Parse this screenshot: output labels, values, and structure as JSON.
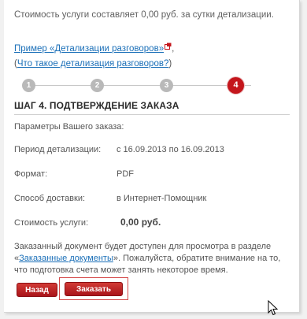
{
  "cost_note": "Стоимость услуги составляет 0,00 руб. за сутки детализации.",
  "links": {
    "example": "Пример «Детализации разговоров»",
    "example_suffix": ",",
    "whatis_open": "(",
    "whatis": "Что такое детализация разговоров?",
    "whatis_close": ")"
  },
  "stepper": {
    "steps": [
      "1",
      "2",
      "3",
      "4"
    ],
    "active_step": 4
  },
  "step_title": "ШАГ 4. ПОДТВЕРЖДЕНИЕ ЗАКАЗА",
  "params": {
    "heading": "Параметры Вашего заказа:",
    "period_label": "Период детализации:",
    "period_value": "с 16.09.2013 по 16.09.2013",
    "format_label": "Формат:",
    "format_value": "PDF",
    "delivery_label": "Способ доставки:",
    "delivery_value": "в Интернет-Помощник",
    "cost_label": "Стоимость услуги:",
    "cost_value": "0,00 руб."
  },
  "notice": {
    "part1": "Заказанный документ будет доступен для просмотра в разделе «",
    "link": "Заказанные документы",
    "part2": "». Пожалуйста, обратите внимание на то, что подготовка счета может занять некоторое время."
  },
  "buttons": {
    "back": "Назад",
    "order": "Заказать"
  },
  "colors": {
    "accent_red": "#c4161c",
    "link_blue": "#1a6fb8",
    "step_inactive": "#b9b9b9"
  }
}
